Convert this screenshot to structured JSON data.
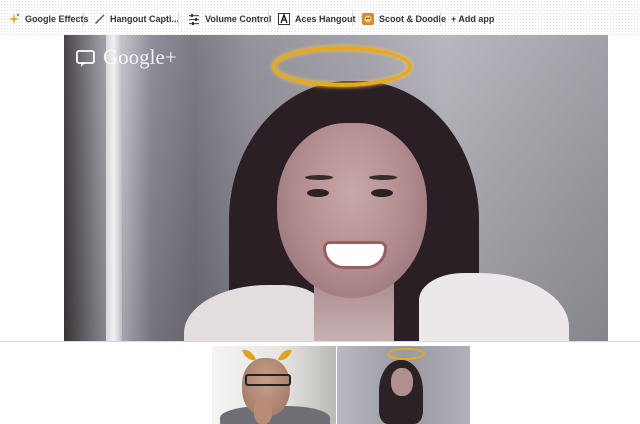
{
  "toolbar": {
    "apps": [
      {
        "label": "Google Effects",
        "icon": "sparkle-icon"
      },
      {
        "label": "Hangout Capti...",
        "icon": "pen-icon"
      },
      {
        "label": "Volume Control",
        "icon": "sliders-icon"
      },
      {
        "label": "Aces Hangout",
        "icon": "ace-card-icon"
      },
      {
        "label": "Scoot & Doodle",
        "icon": "doodle-icon"
      }
    ],
    "add_app_label": "+ Add app"
  },
  "main_video": {
    "watermark": "Google+",
    "effect": "halo"
  },
  "filmstrip": {
    "participants": [
      {
        "effect": "devil-horns"
      },
      {
        "effect": "halo"
      }
    ]
  },
  "colors": {
    "halo": "#e8a91d",
    "toolbar_text": "#333333"
  }
}
